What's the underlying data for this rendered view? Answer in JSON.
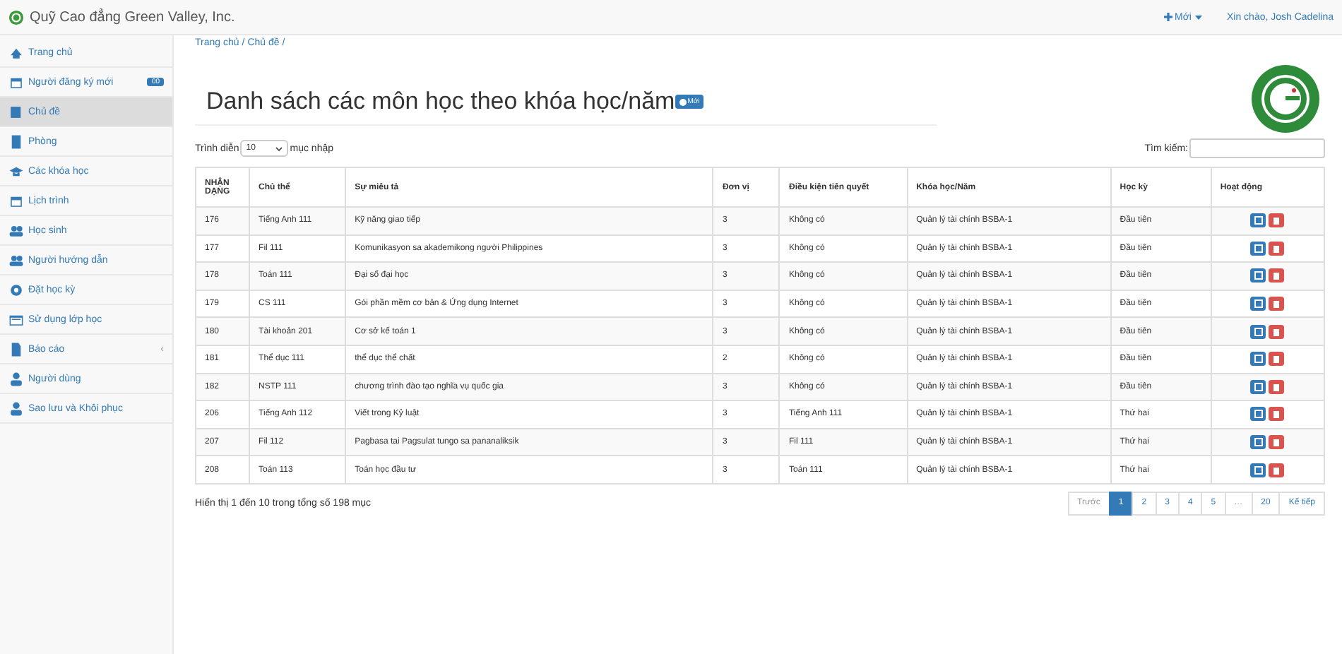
{
  "navbar": {
    "brand": "Quỹ Cao đẳng Green Valley, Inc.",
    "new_menu": "Mới",
    "greeting": "Xin chào, Josh Cadelina"
  },
  "sidebar": {
    "items": [
      {
        "label": "Trang chủ",
        "selected": false
      },
      {
        "label": "Người đăng ký mới",
        "selected": false,
        "badge": "00"
      },
      {
        "label": "Chủ đề",
        "selected": true
      },
      {
        "label": "Phòng",
        "selected": false
      },
      {
        "label": "Các khóa học",
        "selected": false
      },
      {
        "label": "Lịch trình",
        "selected": false
      },
      {
        "label": "Học sinh",
        "selected": false
      },
      {
        "label": "Người hướng dẫn",
        "selected": false
      },
      {
        "label": "Đặt học kỳ",
        "selected": false
      },
      {
        "label": "Sử dụng lớp học",
        "selected": false
      },
      {
        "label": "Báo cáo",
        "selected": false,
        "caret": "‹"
      },
      {
        "label": "Người dùng",
        "selected": false
      },
      {
        "label": "Sao lưu và Khôi phục",
        "selected": false
      }
    ]
  },
  "breadcrumb": [
    {
      "label": "Trang chủ",
      "separator": "/"
    },
    {
      "label": "Chủ đề",
      "separator": "/"
    }
  ],
  "heading": "Danh sách các môn học theo khóa học/năm",
  "new_button": "Mới",
  "length_control": {
    "before": "Trình diễn",
    "value": "10",
    "after": "mục nhập"
  },
  "search": {
    "label": "Tìm kiếm:"
  },
  "table": {
    "columns": [
      "NHẬN DẠNG",
      "Chủ thể",
      "Sự miêu tả",
      "Đơn vị",
      "Điều kiện tiên quyết",
      "Khóa học/Năm",
      "Học kỳ",
      "Hoạt động"
    ],
    "rows": [
      [
        "176",
        "Tiếng Anh 111",
        "Kỹ năng giao tiếp",
        "3",
        "Không có",
        "Quản lý tài chính BSBA-1",
        "Đầu tiên"
      ],
      [
        "177",
        "Fil 111",
        "Komunikasyon sa akademikong người Philippines",
        "3",
        "Không có",
        "Quản lý tài chính BSBA-1",
        "Đầu tiên"
      ],
      [
        "178",
        "Toán 111",
        "Đại số đại học",
        "3",
        "Không có",
        "Quản lý tài chính BSBA-1",
        "Đầu tiên"
      ],
      [
        "179",
        "CS 111",
        "Gói phần mềm cơ bản & Ứng dụng Internet",
        "3",
        "Không có",
        "Quản lý tài chính BSBA-1",
        "Đầu tiên"
      ],
      [
        "180",
        "Tài khoản 201",
        "Cơ sở kế toán 1",
        "3",
        "Không có",
        "Quản lý tài chính BSBA-1",
        "Đầu tiên"
      ],
      [
        "181",
        "Thể dục 111",
        "thể dục thể chất",
        "2",
        "Không có",
        "Quản lý tài chính BSBA-1",
        "Đầu tiên"
      ],
      [
        "182",
        "NSTP 111",
        "chương trình đào tạo nghĩa vụ quốc gia",
        "3",
        "Không có",
        "Quản lý tài chính BSBA-1",
        "Đầu tiên"
      ],
      [
        "206",
        "Tiếng Anh 112",
        "Viết trong Kỷ luật",
        "3",
        "Tiếng Anh 111",
        "Quản lý tài chính BSBA-1",
        "Thứ hai"
      ],
      [
        "207",
        "Fil 112",
        "Pagbasa tai Pagsulat tungo sa pananaliksik",
        "3",
        "Fil 111",
        "Quản lý tài chính BSBA-1",
        "Thứ hai"
      ],
      [
        "208",
        "Toán 113",
        "Toán học đầu tư",
        "3",
        "Toán 111",
        "Quản lý tài chính BSBA-1",
        "Thứ hai"
      ]
    ]
  },
  "info": "Hiển thị 1 đến 10 trong tổng số 198 mục",
  "pagination": [
    {
      "label": "Trước",
      "selected": false,
      "disabled": true
    },
    {
      "label": "1",
      "selected": true,
      "disabled": false
    },
    {
      "label": "2",
      "selected": false,
      "disabled": false
    },
    {
      "label": "3",
      "selected": false,
      "disabled": false
    },
    {
      "label": "4",
      "selected": false,
      "disabled": false
    },
    {
      "label": "5",
      "selected": false,
      "disabled": false
    },
    {
      "label": "…",
      "selected": false,
      "disabled": true
    },
    {
      "label": "20",
      "selected": false,
      "disabled": false
    },
    {
      "label": "Kế tiếp",
      "selected": false,
      "disabled": false
    }
  ]
}
